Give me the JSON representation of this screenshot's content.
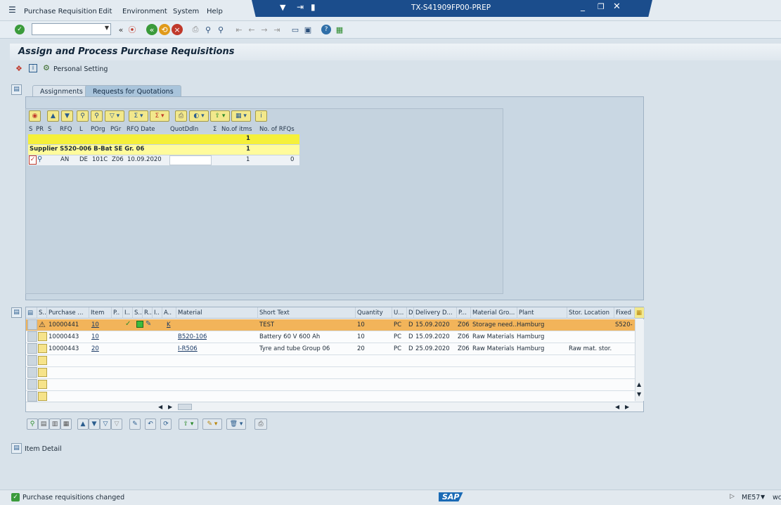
{
  "menubar": {
    "items": [
      "Purchase Requisition",
      "Edit",
      "Environment",
      "System",
      "Help"
    ],
    "system_title": "TX-S41909FP00-PREP"
  },
  "toolbar": {
    "command_value": ""
  },
  "page": {
    "title": "Assign and Process Purchase Requisitions",
    "personal_setting": "Personal Setting"
  },
  "tabs": [
    "Assignments",
    "Requests for Quotations"
  ],
  "rfq_table": {
    "headers": [
      "S",
      "PR",
      "S",
      "RFQ",
      "L",
      "POrg",
      "PGr",
      "RFQ Date",
      "QuotDdln",
      "Σ",
      "No.of itms",
      "No. of RFQs"
    ],
    "total_row": {
      "items": "1"
    },
    "supplier_row": {
      "label": "Supplier S520-006 B-Bat SE Gr. 06",
      "items": "1"
    },
    "detail_row": {
      "rfq": "AN",
      "lang": "DE",
      "porg": "101C",
      "pgr": "Z06",
      "date": "10.09.2020",
      "items": "1",
      "rfqs": "0"
    }
  },
  "item_grid": {
    "headers": [
      "S..",
      "Purchase ...",
      "Item",
      "P..",
      "I..",
      "S..",
      "R..",
      "I..",
      "A..",
      "Material",
      "Short Text",
      "Quantity",
      "U...",
      "D",
      "Delivery D...",
      "P...",
      "Material Gro...",
      "Plant",
      "Stor. Location",
      "Fixed"
    ],
    "rows": [
      {
        "pr": "10000441",
        "item": "10",
        "a": "K",
        "material": "",
        "text": "TEST",
        "qty": "10",
        "unit": "PC",
        "d": "D",
        "date": "15.09.2020",
        "p": "Z06",
        "mgroup": "Storage need...",
        "plant": "Hamburg",
        "sloc": "",
        "fixed": "S520-"
      },
      {
        "pr": "10000443",
        "item": "10",
        "a": "",
        "material": "B520-106",
        "text": "Battery 60 V 600 Ah",
        "qty": "10",
        "unit": "PC",
        "d": "D",
        "date": "15.09.2020",
        "p": "Z06",
        "mgroup": "Raw Materials",
        "plant": "Hamburg",
        "sloc": "",
        "fixed": ""
      },
      {
        "pr": "10000443",
        "item": "20",
        "a": "",
        "material": "I-R506",
        "text": "Tyre and tube Group 06",
        "qty": "20",
        "unit": "PC",
        "d": "D",
        "date": "25.09.2020",
        "p": "Z06",
        "mgroup": "Raw Materials",
        "plant": "Hamburg",
        "sloc": "Raw mat. stor.",
        "fixed": ""
      }
    ]
  },
  "item_detail": {
    "label": "Item Detail"
  },
  "status": {
    "message": "Purchase requisitions changed",
    "transaction": "ME57",
    "server": "wc",
    "logo": "SAP"
  },
  "colors": {
    "title_band": "#1b4d8c",
    "highlight_row": "#f2b45a",
    "supplier_row": "#fffb9c",
    "total_row": "#f5f03a"
  }
}
